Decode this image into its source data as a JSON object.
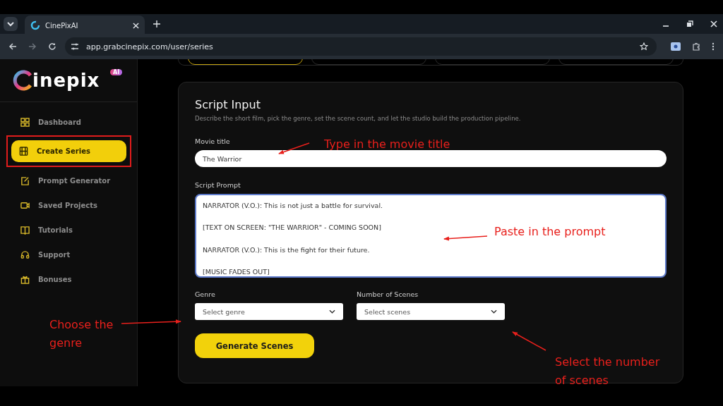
{
  "browser": {
    "tab_title": "CinePixAI",
    "url": "app.grabcinepix.com/user/series"
  },
  "logo": {
    "text": "inepix",
    "badge": "AI"
  },
  "sidebar": {
    "items": [
      {
        "label": "Dashboard",
        "kind": "grid",
        "selected": false,
        "highlighted": false
      },
      {
        "label": "Create Series",
        "kind": "film",
        "selected": true,
        "highlighted": true
      },
      {
        "label": "Prompt Generator",
        "kind": "edit",
        "selected": false,
        "highlighted": false
      },
      {
        "label": "Saved Projects",
        "kind": "video",
        "selected": false,
        "highlighted": false
      },
      {
        "label": "Tutorials",
        "kind": "book",
        "selected": false,
        "highlighted": false
      },
      {
        "label": "Support",
        "kind": "headset",
        "selected": false,
        "highlighted": false
      },
      {
        "label": "Bonuses",
        "kind": "gift",
        "selected": false,
        "highlighted": false
      }
    ]
  },
  "step_tabs": [
    {
      "selected": true
    },
    {
      "selected": false
    },
    {
      "selected": false
    },
    {
      "selected": false
    }
  ],
  "card": {
    "title": "Script Input",
    "description": "Describe the short film, pick the genre, set the scene count, and let the studio build the production pipeline.",
    "movie_title": {
      "label": "Movie title",
      "value": "The Warrior"
    },
    "script_prompt": {
      "label": "Script Prompt",
      "lines": [
        "NARRATOR (V.O.): This is not just a battle for survival.",
        "[TEXT ON SCREEN: \"THE WARRIOR\" - COMING SOON]",
        "NARRATOR (V.O.): This is the fight for their future.",
        "[MUSIC FADES OUT]"
      ]
    },
    "genre": {
      "label": "Genre",
      "placeholder": "Select genre"
    },
    "scenes": {
      "label": "Number of Scenes",
      "placeholder": "Select scenes"
    },
    "button": "Generate Scenes"
  },
  "annotations": [
    {
      "text": "Type in the movie title"
    },
    {
      "text": "Paste in the prompt"
    },
    {
      "text": "Choose the genre"
    },
    {
      "text": "Select the number of scenes"
    }
  ]
}
